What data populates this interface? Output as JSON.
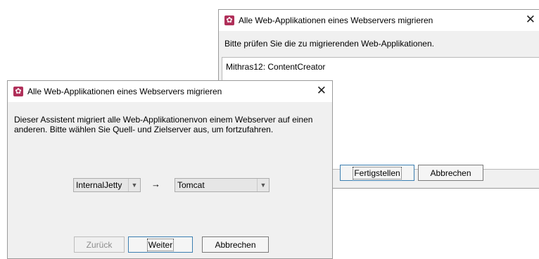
{
  "back_dialog": {
    "title": "Alle Web-Applikationen eines Webservers migrieren",
    "instruction": "Bitte prüfen Sie die zu migrierenden Web-Applikationen.",
    "list_items": [
      "Mithras12: ContentCreator"
    ],
    "buttons": {
      "finish": "Fertigstellen",
      "cancel": "Abbrechen"
    }
  },
  "front_dialog": {
    "title": "Alle Web-Applikationen eines Webservers migrieren",
    "description": "Dieser Assistent migriert alle Web-Applikationenvon einem Webserver auf einen anderen. Bitte wählen Sie Quell- und Zielserver aus, um fortzufahren.",
    "source_server": "InternalJetty",
    "arrow": "→",
    "target_server": "Tomcat",
    "buttons": {
      "back": "Zurück",
      "next": "Weiter",
      "cancel": "Abbrechen"
    }
  },
  "icons": {
    "app": "gear-icon",
    "close": "close-icon",
    "dropdown": "chevron-down-icon"
  },
  "colors": {
    "app_icon": "#b0305a",
    "focus_border": "#3c7fb1",
    "dialog_bg": "#f0f0f0"
  }
}
